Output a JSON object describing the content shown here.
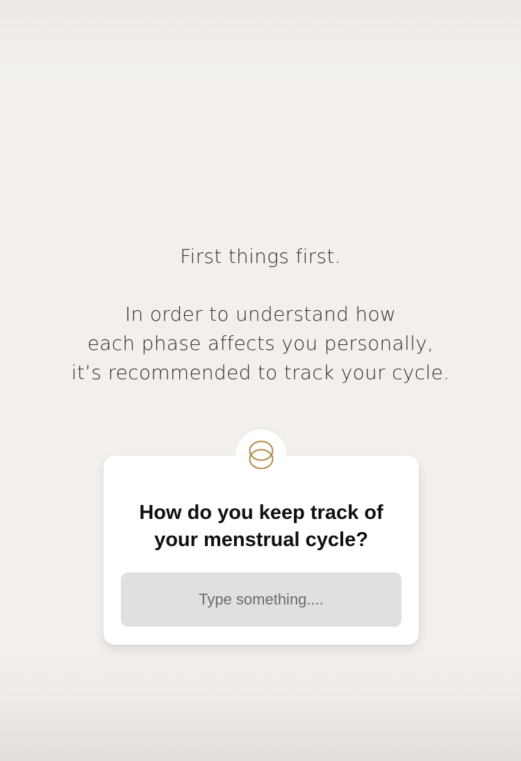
{
  "intro": {
    "title": "First things first.",
    "body_lines": [
      "In order to understand how",
      "each phase affects you personally,",
      "it’s recommended to track your cycle."
    ]
  },
  "card": {
    "icon": "interlocking-rings-icon",
    "accent_color": "#b08a48",
    "question_lines": [
      "How do you keep track of",
      "your menstrual cycle?"
    ],
    "answer": {
      "value": "",
      "placeholder": "Type something...."
    }
  }
}
